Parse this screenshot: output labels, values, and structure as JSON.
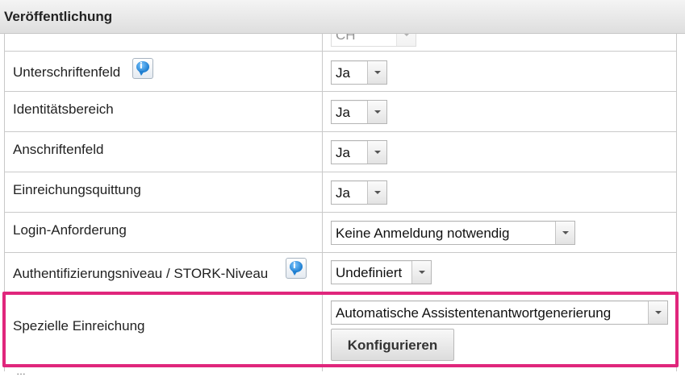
{
  "panel": {
    "title": "Veröffentlichung"
  },
  "rows": {
    "partial_top": {
      "value": "CH"
    },
    "signature_field": {
      "label": "Unterschriftenfeld",
      "value": "Ja"
    },
    "identity_area": {
      "label": "Identitätsbereich",
      "value": "Ja"
    },
    "address_field": {
      "label": "Anschriftenfeld",
      "value": "Ja"
    },
    "submission_receipt": {
      "label": "Einreichungsquittung",
      "value": "Ja"
    },
    "login_requirement": {
      "label": "Login-Anforderung",
      "value": "Keine Anmeldung notwendig"
    },
    "auth_level": {
      "label": "Authentifizierungsniveau / STORK-Niveau",
      "value": "Undefiniert"
    },
    "special_submission": {
      "label": "Spezielle Einreichung",
      "value": "Automatische Assistentenantwortgenerierung",
      "button_label": "Konfigurieren"
    }
  },
  "partial_bottom_text": "…",
  "icons": {
    "info": "info-bubble-icon",
    "dropdown": "chevron-down-icon"
  },
  "colors": {
    "highlight": "#e0267c",
    "info_icon": "#1f7fd1"
  }
}
